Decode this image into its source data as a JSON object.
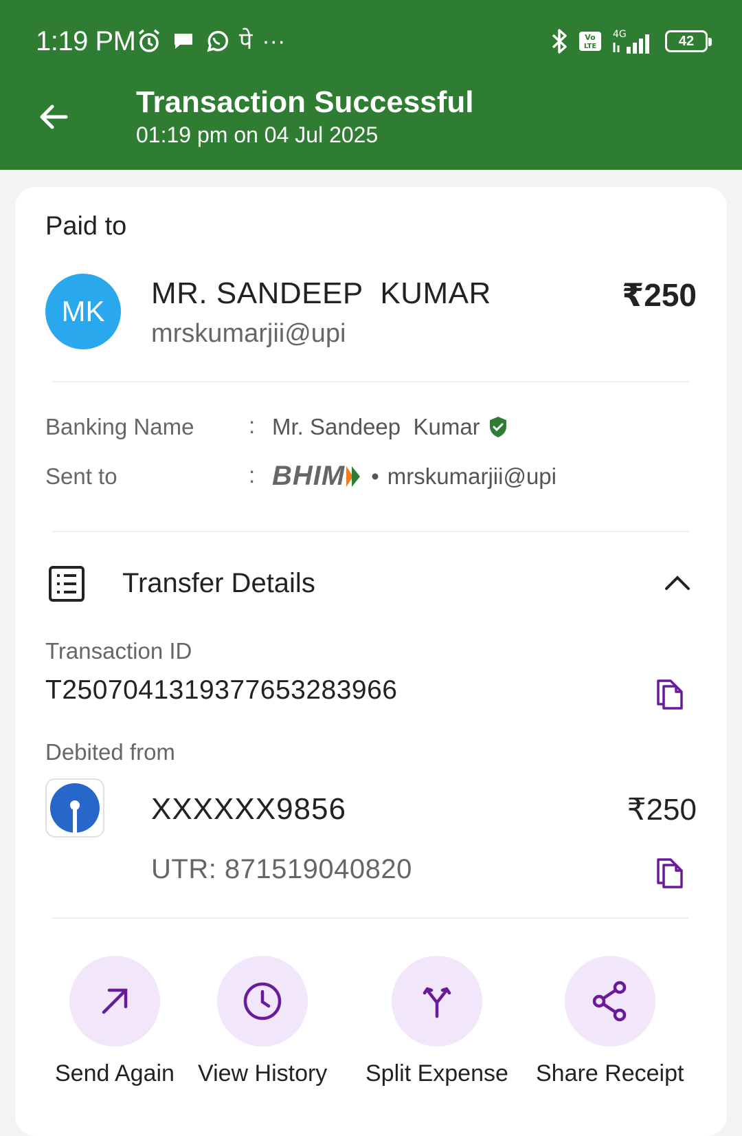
{
  "status_bar": {
    "time": "1:19 PM",
    "network": "4G",
    "volte": "Vo LTE",
    "battery": "42",
    "app_glyph": "पे",
    "more": "···"
  },
  "header": {
    "title": "Transaction Successful",
    "subtitle": "01:19 pm on 04 Jul 2025",
    "bg_color": "#2e7d32"
  },
  "payee": {
    "section_label": "Paid to",
    "avatar_initials": "MK",
    "name": "MR. SANDEEP  KUMAR",
    "vpa": "mrskumarjii@upi",
    "amount": "₹250",
    "avatar_color": "#2aa8ee"
  },
  "details": {
    "banking_name_label": "Banking Name",
    "banking_name_value": "Mr. Sandeep  Kumar",
    "sent_to_label": "Sent to",
    "sent_to_app": "BHIM",
    "sent_to_vpa": "mrskumarjii@upi",
    "separator": ":",
    "dot": "•"
  },
  "transfer": {
    "title": "Transfer Details",
    "txn_id_label": "Transaction ID",
    "txn_id": "T2507041319377653283966",
    "debited_label": "Debited from",
    "account": "XXXXXX9856",
    "account_amount": "₹250",
    "utr": "UTR: 871519040820"
  },
  "actions": [
    {
      "label": "Send Again",
      "icon": "arrow-up-right-icon"
    },
    {
      "label": "View History",
      "icon": "clock-icon"
    },
    {
      "label": "Split Expense",
      "icon": "split-icon"
    },
    {
      "label": "Share Receipt",
      "icon": "share-icon"
    }
  ],
  "colors": {
    "accent_purple": "#6a1b9a",
    "action_bg": "#f1e6fa",
    "verified_green": "#2e7d32"
  }
}
